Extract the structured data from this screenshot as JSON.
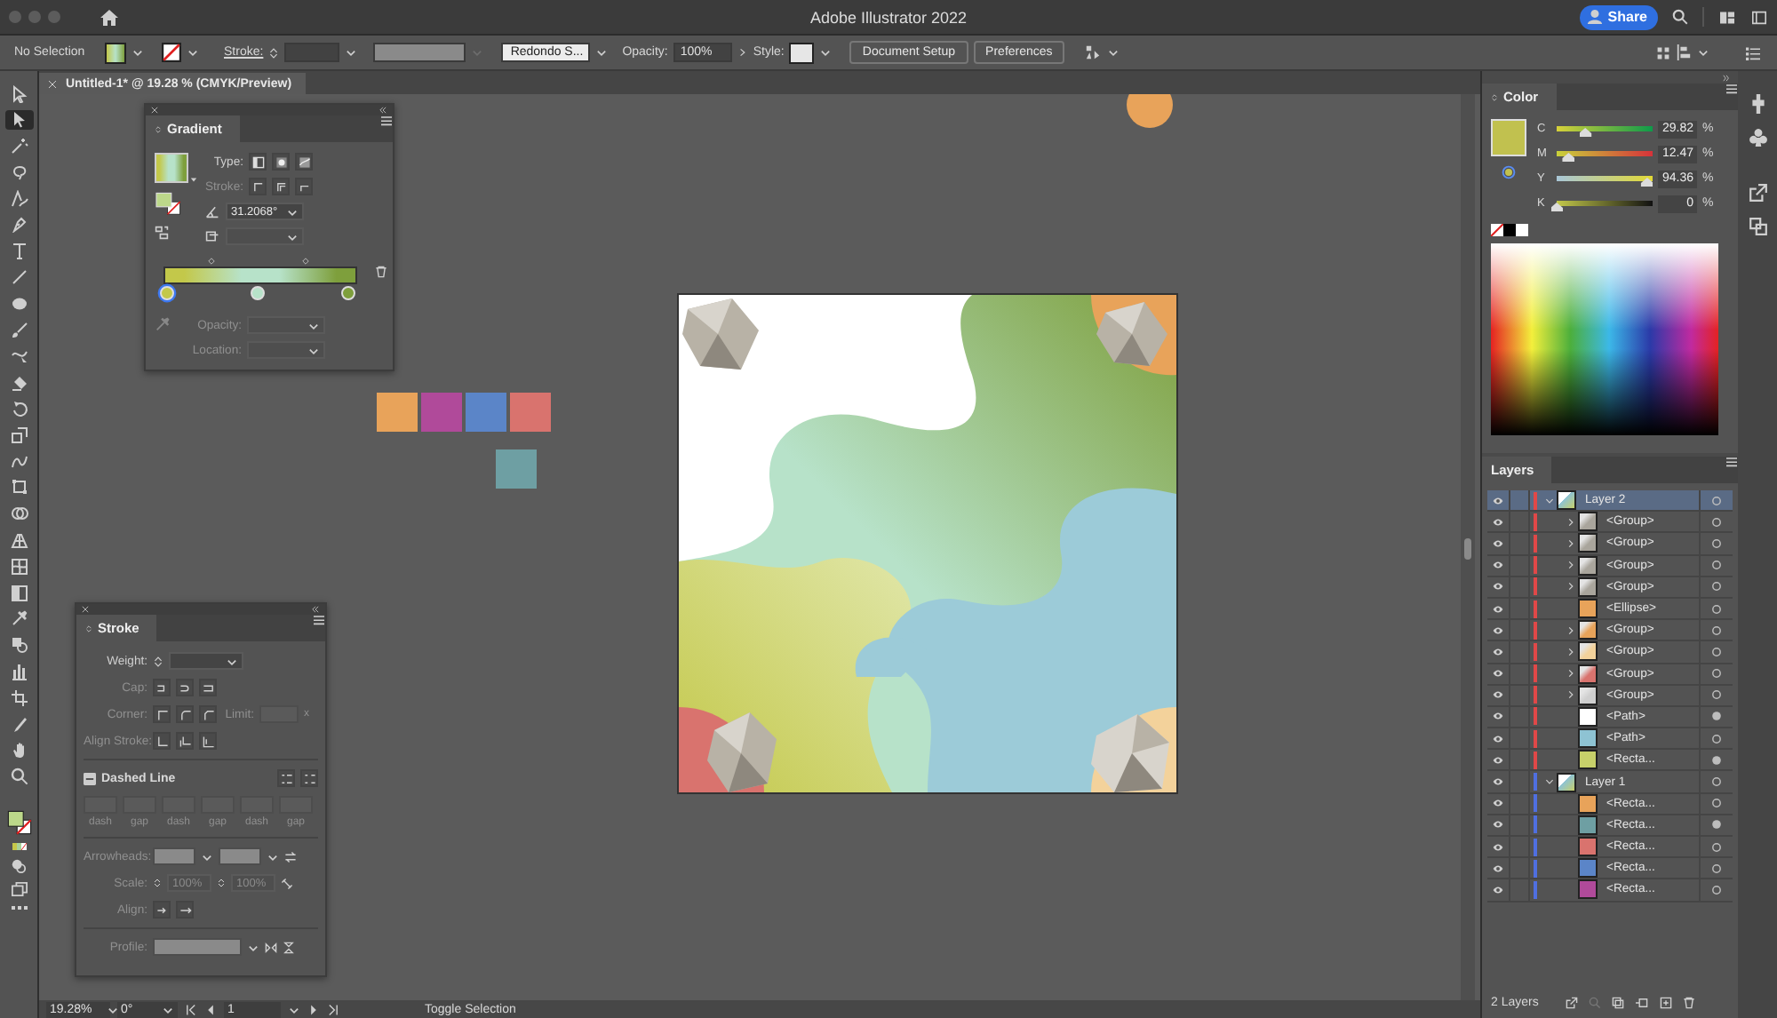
{
  "window": {
    "title": "Adobe Illustrator 2022"
  },
  "share_button": {
    "label": "Share"
  },
  "control_bar": {
    "selection": "No Selection",
    "stroke_label": "Stroke:",
    "brush": "Redondo S...",
    "opacity_label": "Opacity:",
    "opacity": "100%",
    "style_label": "Style:",
    "buttons": [
      "Document Setup",
      "Preferences"
    ]
  },
  "document_tab": {
    "title": "Untitled-1* @ 19.28 % (CMYK/Preview)"
  },
  "toolbar": {
    "tools": [
      {
        "kind": "direct-select",
        "selected": false
      },
      {
        "kind": "select",
        "selected": true
      },
      {
        "kind": "magic-wand",
        "selected": false
      },
      {
        "kind": "lasso",
        "selected": false
      },
      {
        "kind": "curvature",
        "selected": false
      },
      {
        "kind": "pen",
        "selected": false
      },
      {
        "kind": "type",
        "selected": false
      },
      {
        "kind": "line",
        "selected": false
      },
      {
        "kind": "ellipse",
        "selected": false
      },
      {
        "kind": "brush",
        "selected": false
      },
      {
        "kind": "shaper",
        "selected": false
      },
      {
        "kind": "eraser",
        "selected": false
      },
      {
        "kind": "rotate",
        "selected": false
      },
      {
        "kind": "scale",
        "selected": false
      },
      {
        "kind": "warp",
        "selected": false
      },
      {
        "kind": "free-transform",
        "selected": false
      },
      {
        "kind": "shape-builder",
        "selected": false
      },
      {
        "kind": "perspective",
        "selected": false
      },
      {
        "kind": "mesh",
        "selected": false
      },
      {
        "kind": "gradient",
        "selected": false
      },
      {
        "kind": "eyedropper",
        "selected": false
      },
      {
        "kind": "blend",
        "selected": false
      },
      {
        "kind": "graph",
        "selected": false
      },
      {
        "kind": "artboard",
        "selected": false
      },
      {
        "kind": "knife",
        "selected": false
      },
      {
        "kind": "hand",
        "selected": false
      },
      {
        "kind": "zoom",
        "selected": false
      }
    ]
  },
  "canvas_shapes": [
    {
      "color": "#e8a35a"
    },
    {
      "color": "#b04a9a"
    },
    {
      "color": "#5b85c8"
    },
    {
      "color": "#d9736e"
    },
    {
      "color": "#6e9fa3"
    }
  ],
  "gradient_panel": {
    "title": "Gradient",
    "type_label": "Type:",
    "stroke_label": "Stroke:",
    "angle": "31.2068°",
    "opacity_label": "Opacity:",
    "location_label": "Location:",
    "stops": [
      {
        "color": "#c3c84a",
        "selected": true
      },
      {
        "color": "#b7e2c9",
        "selected": false
      },
      {
        "color": "#7e9f3c",
        "selected": false
      }
    ]
  },
  "stroke_panel": {
    "title": "Stroke",
    "weight_label": "Weight:",
    "cap_label": "Cap:",
    "corner_label": "Corner:",
    "limit_label": "Limit:",
    "limit_unit": "x",
    "align_stroke_label": "Align Stroke:",
    "dashed_line_label": "Dashed Line",
    "dash_labels": [
      "dash",
      "gap",
      "dash",
      "gap",
      "dash",
      "gap"
    ],
    "arrowheads_label": "Arrowheads:",
    "scale_label": "Scale:",
    "scale_values": [
      "100%",
      "100%"
    ],
    "align_label": "Align:",
    "profile_label": "Profile:"
  },
  "color_panel": {
    "title": "Color",
    "channels": [
      {
        "name": "C",
        "level": 0.2982,
        "reading": "29.82",
        "unit": "%"
      },
      {
        "name": "M",
        "level": 0.1247,
        "reading": "12.47",
        "unit": "%"
      },
      {
        "name": "Y",
        "level": 0.9436,
        "reading": "94.36",
        "unit": "%"
      },
      {
        "name": "K",
        "level": 0,
        "reading": "0",
        "unit": "%"
      }
    ]
  },
  "layers_panel": {
    "title": "Layers",
    "count": "2 Layers",
    "layers": [
      {
        "name": "Layer 2",
        "color": "#e04848",
        "expanded": true,
        "selected": true,
        "targeted": false,
        "children": [
          {
            "name": "<Group>",
            "kind": "group",
            "expanded": false,
            "color": "#a9a59c",
            "targeted": false
          },
          {
            "name": "<Group>",
            "kind": "group",
            "expanded": false,
            "color": "#a9a59c",
            "targeted": false
          },
          {
            "name": "<Group>",
            "kind": "group",
            "expanded": false,
            "color": "#a9a59c",
            "targeted": false
          },
          {
            "name": "<Group>",
            "kind": "group",
            "expanded": false,
            "color": "#a9a59c",
            "targeted": false
          },
          {
            "name": "<Ellipse>",
            "kind": "object",
            "color": "#e8a35a",
            "targeted": false
          },
          {
            "name": "<Group>",
            "kind": "group",
            "expanded": false,
            "color": "#e8a35a",
            "targeted": false
          },
          {
            "name": "<Group>",
            "kind": "group",
            "expanded": false,
            "color": "#f3d29b",
            "targeted": false
          },
          {
            "name": "<Group>",
            "kind": "group",
            "expanded": false,
            "color": "#d9736e",
            "targeted": false
          },
          {
            "name": "<Group>",
            "kind": "group",
            "expanded": false,
            "color": "#cfcfcf",
            "targeted": false
          },
          {
            "name": "<Path>",
            "kind": "object",
            "color": "#ffffff",
            "targeted": true
          },
          {
            "name": "<Path>",
            "kind": "object",
            "color": "#8ec3d3",
            "targeted": false
          },
          {
            "name": "<Recta...",
            "kind": "object",
            "color": "#c7d06a",
            "targeted": true
          }
        ]
      },
      {
        "name": "Layer 1",
        "color": "#4f6fe0",
        "expanded": true,
        "selected": false,
        "targeted": false,
        "children": [
          {
            "name": "<Recta...",
            "kind": "object",
            "color": "#e8a35a",
            "targeted": false
          },
          {
            "name": "<Recta...",
            "kind": "object",
            "color": "#6e9fa3",
            "targeted": true
          },
          {
            "name": "<Recta...",
            "kind": "object",
            "color": "#d9736e",
            "targeted": false
          },
          {
            "name": "<Recta...",
            "kind": "object",
            "color": "#5b85c8",
            "targeted": false
          },
          {
            "name": "<Recta...",
            "kind": "object",
            "color": "#b04a9a",
            "targeted": false
          }
        ]
      }
    ]
  },
  "status_bar": {
    "zoom": "19.28%",
    "rotation": "0°",
    "artboard": "1",
    "status": "Toggle Selection"
  }
}
